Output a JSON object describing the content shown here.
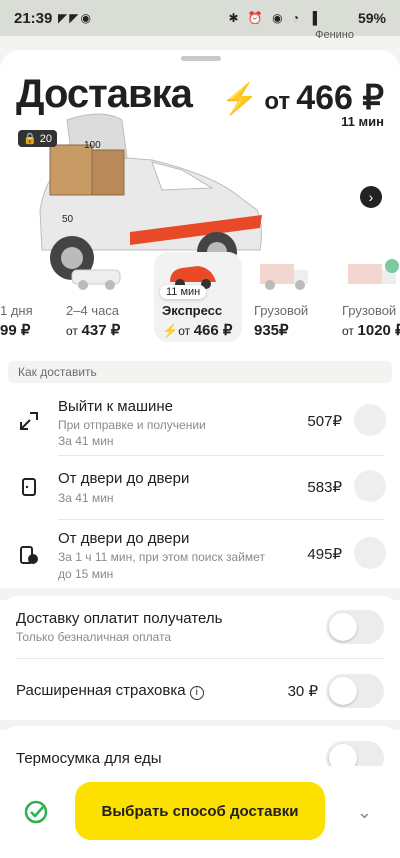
{
  "status_bar": {
    "time": "21:39",
    "battery": "59%",
    "network": "VoLTE",
    "left_icons": "◤◤◉",
    "right_icons": "✱ ⏰ ◉ ◔ ▐"
  },
  "map_label": "Фенино",
  "header": {
    "title": "Доставка",
    "price_from": "от",
    "price": "466 ₽",
    "eta": "11 мин",
    "cargo_badge": "20",
    "dim_width": "100",
    "dim_height": "50"
  },
  "tariffs": [
    {
      "name": "1 дня",
      "price_from": "",
      "price": "99 ₽",
      "eta": ""
    },
    {
      "name": "2–4 часа",
      "price_from": "от",
      "price": "437 ₽",
      "eta": ""
    },
    {
      "name": "Экспресс",
      "price_from": "от",
      "price": "466 ₽",
      "eta": "11 мин"
    },
    {
      "name": "Грузовой",
      "price_from": "",
      "price": "935₽",
      "eta": ""
    },
    {
      "name": "Грузовой",
      "price_from": "от",
      "price": "1020 ₽",
      "eta": ""
    }
  ],
  "section_label": "Как доставить",
  "options": [
    {
      "title": "Выйти к машине",
      "subtitle": "При отправке и получении",
      "subtitle2": "За 41 мин",
      "price": "507₽"
    },
    {
      "title": "От двери до двери",
      "subtitle": "За 41 мин",
      "subtitle2": "",
      "price": "583₽"
    },
    {
      "title": "От двери до двери",
      "subtitle": "За 1 ч 11 мин, при этом поиск займет",
      "subtitle2": "до 15 мин",
      "price": "495₽"
    }
  ],
  "toggles": [
    {
      "label": "Доставку оплатит получатель",
      "subtitle": "Только безналичная оплата"
    },
    {
      "label": "Расширенная страховка",
      "price": "30 ₽"
    },
    {
      "label": "Термосумка для еды"
    }
  ],
  "cta": "Выбрать способ доставки",
  "colors": {
    "accent": "#fce000",
    "bolt": "#f7a600",
    "car_stripe": "#e84a27"
  }
}
